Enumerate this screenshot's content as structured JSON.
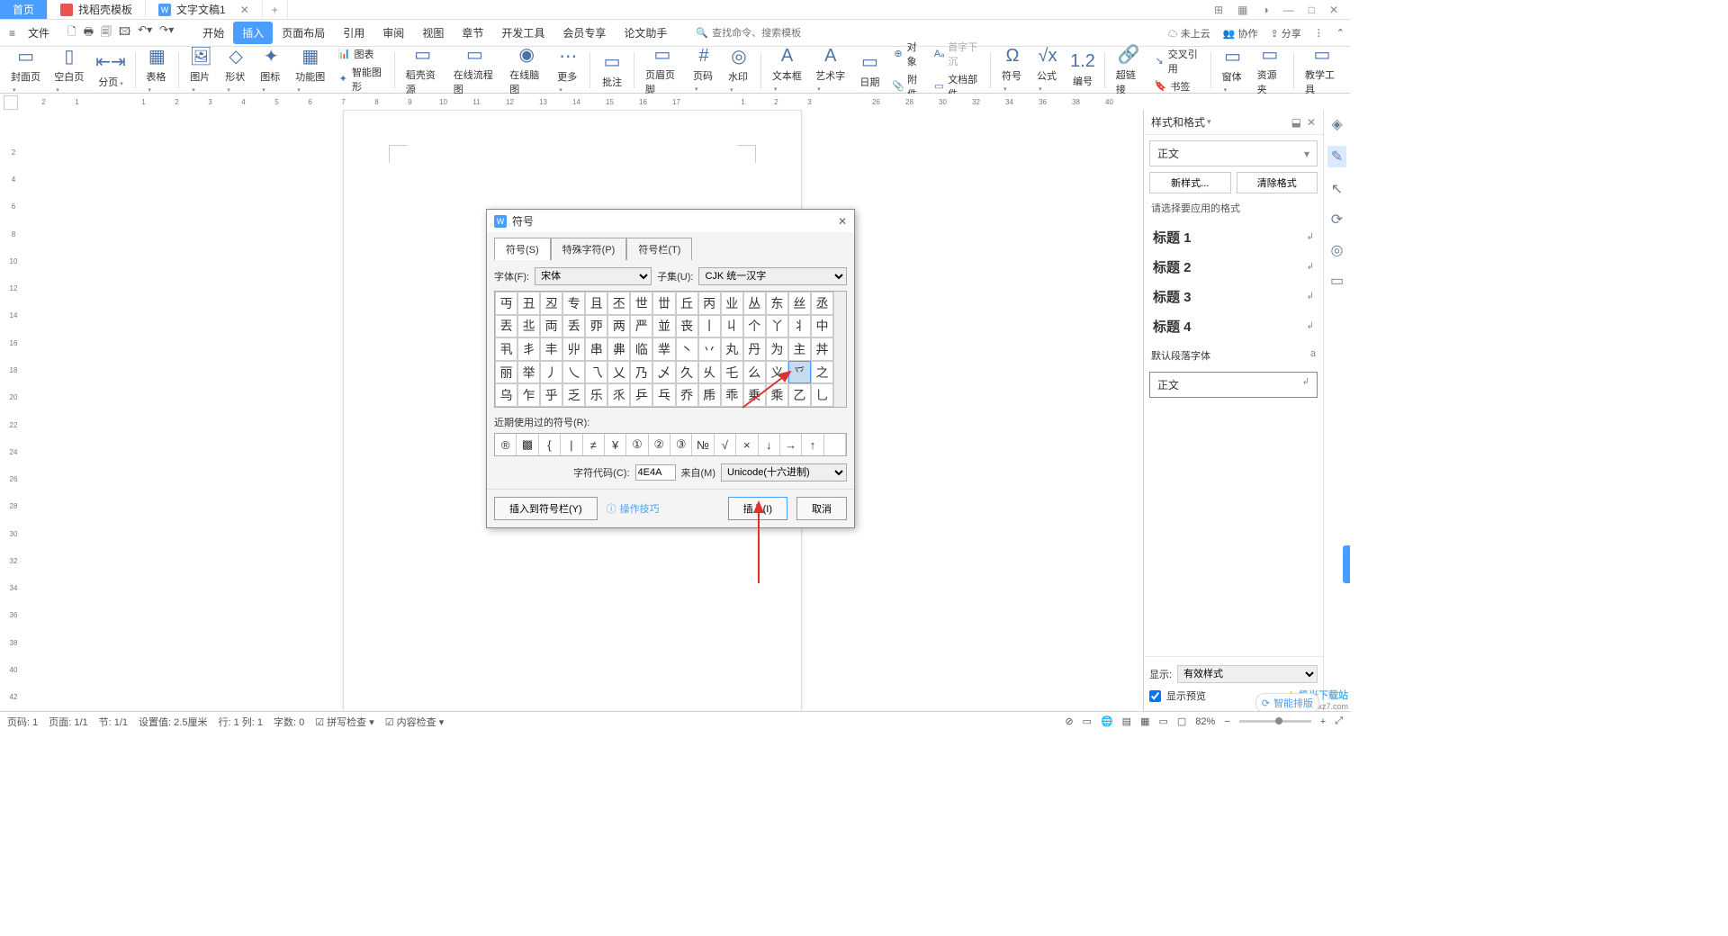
{
  "titlebar": {
    "tabs": [
      {
        "label": "首页",
        "type": "home"
      },
      {
        "label": "找稻壳模板",
        "icon": "d"
      },
      {
        "label": "文字文稿1",
        "icon": "w",
        "closable": true
      }
    ],
    "add": "+",
    "win_icons": [
      "⊞",
      "▦",
      "◑",
      "—",
      "□",
      "✕"
    ]
  },
  "menubar": {
    "file": "文件",
    "qa_icons": [
      "🗋",
      "🖶",
      "🗐",
      "🖾",
      "↶▾",
      "↷▾"
    ],
    "tabs": [
      "开始",
      "插入",
      "页面布局",
      "引用",
      "审阅",
      "视图",
      "章节",
      "开发工具",
      "会员专享",
      "论文助手"
    ],
    "active_tab": 1,
    "search_icon": "🔍",
    "search_placeholder": "查找命令、搜索模板",
    "right": {
      "cloud": "未上云",
      "collab": "协作",
      "share": "分享"
    }
  },
  "ribbon": {
    "items": [
      {
        "icon": "▭",
        "label": "封面页"
      },
      {
        "icon": "▯",
        "label": "空白页"
      },
      {
        "icon": "⇤⇥",
        "label": "分页"
      },
      {
        "icon": "▦",
        "label": "表格"
      },
      {
        "icon": "🖼",
        "label": "图片"
      },
      {
        "icon": "◇",
        "label": "形状"
      },
      {
        "icon": "✦",
        "label": "图标"
      },
      {
        "icon": "▦",
        "label": "功能图"
      },
      {
        "icon": "📊",
        "side_label": "图表",
        "label": "智能图形"
      },
      {
        "icon": "▭",
        "label": "稻壳资源"
      },
      {
        "icon": "▭",
        "label": "在线流程图"
      },
      {
        "icon": "◉",
        "label": "在线脑图"
      },
      {
        "icon": "⋯",
        "label": "更多"
      },
      {
        "icon": "▭",
        "label": "批注"
      },
      {
        "icon": "▭",
        "label": "页眉页脚"
      },
      {
        "icon": "#",
        "label": "页码"
      },
      {
        "icon": "◎",
        "label": "水印"
      },
      {
        "icon": "A",
        "label": "文本框"
      },
      {
        "icon": "A",
        "label": "艺术字"
      },
      {
        "icon": "▭",
        "label": "日期"
      },
      {
        "icon": "⊕",
        "side_label": "附件",
        "top_label": "对象",
        "disabled_label": "首字下沉",
        "label": "文档部件"
      },
      {
        "icon": "Ω",
        "label": "符号"
      },
      {
        "icon": "√x",
        "label": "公式"
      },
      {
        "icon": "1.2",
        "label": "编号"
      },
      {
        "icon": "🔗",
        "label": "超链接"
      },
      {
        "icon": "▭",
        "side_label": "书签",
        "top_label": "交叉引用"
      },
      {
        "icon": "▭",
        "label": "窗体"
      },
      {
        "icon": "▭",
        "label": "资源夹"
      },
      {
        "icon": "▭",
        "label": "教学工具"
      }
    ]
  },
  "ruler_h": [
    "2",
    "1",
    "",
    "1",
    "2",
    "3",
    "4",
    "5",
    "6",
    "7",
    "8",
    "9",
    "10",
    "11",
    "12",
    "13",
    "14",
    "15",
    "16",
    "17",
    "",
    "1",
    "2",
    "3",
    "",
    "26",
    "28",
    "30",
    "32",
    "34",
    "36",
    "38",
    "40"
  ],
  "ruler_v": [
    "",
    "2",
    "4",
    "6",
    "8",
    "10",
    "12",
    "14",
    "16",
    "18",
    "20",
    "22",
    "24",
    "26",
    "28",
    "30",
    "32",
    "34",
    "36",
    "38",
    "40",
    "42"
  ],
  "dialog": {
    "title": "符号",
    "tabs": [
      "符号(S)",
      "特殊字符(P)",
      "符号栏(T)"
    ],
    "font_label": "字体(F):",
    "font_value": "宋体",
    "subset_label": "子集(U):",
    "subset_value": "CJK 统一汉字",
    "chars": [
      "丏",
      "丑",
      "丒",
      "专",
      "且",
      "丕",
      "世",
      "丗",
      "丘",
      "丙",
      "业",
      "丛",
      "东",
      "丝",
      "丞",
      "丟",
      "丠",
      "両",
      "丢",
      "丣",
      "两",
      "严",
      "並",
      "丧",
      "丨",
      "丩",
      "个",
      "丫",
      "丬",
      "中",
      "丮",
      "丯",
      "丰",
      "丱",
      "串",
      "丳",
      "临",
      "丵",
      "丶",
      "丷",
      "丸",
      "丹",
      "为",
      "主",
      "丼",
      "丽",
      "举",
      "丿",
      "乀",
      "乁",
      "乂",
      "乃",
      "乄",
      "久",
      "乆",
      "乇",
      "么",
      "义",
      "乊",
      "之",
      "乌",
      "乍",
      "乎",
      "乏",
      "乐",
      "乑",
      "乒",
      "乓",
      "乔",
      "乕",
      "乖",
      "乗",
      "乘",
      "乙",
      "乚"
    ],
    "selected_char_index": 58,
    "recent_label": "近期使用过的符号(R):",
    "recents": [
      "®",
      "▩",
      "{",
      "|",
      "≠",
      "¥",
      "①",
      "②",
      "③",
      "№",
      "√",
      "×",
      "↓",
      "→",
      "↑",
      ""
    ],
    "code_label": "字符代码(C):",
    "code_value": "4E4A",
    "from_label": "来自(M)",
    "from_value": "Unicode(十六进制)",
    "insert_to_bar": "插入到符号栏(Y)",
    "tips_label": "操作技巧",
    "insert_btn": "插入(I)",
    "cancel_btn": "取消"
  },
  "styles_panel": {
    "title": "样式和格式",
    "current": "正文",
    "new_style": "新样式...",
    "clear": "清除格式",
    "hint": "请选择要应用的格式",
    "list": [
      "标题 1",
      "标题 2",
      "标题 3",
      "标题 4"
    ],
    "default_para": "默认段落字体",
    "applied": "正文",
    "show_label": "显示:",
    "show_value": "有效样式",
    "preview_check": "显示预览"
  },
  "rside_icons": [
    "◈",
    "✎",
    "↖",
    "⟳",
    "◎",
    "▭"
  ],
  "statusbar": {
    "left": [
      "页码: 1",
      "页面: 1/1",
      "节: 1/1",
      "设置值: 2.5厘米",
      "行: 1 列: 1",
      "字数: 0",
      "拼写检查 ▾",
      "内容检查 ▾"
    ],
    "right": {
      "icons": [
        "⊘",
        "▭",
        "🌐",
        "▤",
        "▦",
        "▭",
        "▢"
      ],
      "zoom": "82%",
      "minus": "−",
      "plus": "+"
    }
  },
  "watermark": {
    "brand": "极光下载站",
    "url": "www.xz7.com"
  },
  "chip": "智能排版"
}
